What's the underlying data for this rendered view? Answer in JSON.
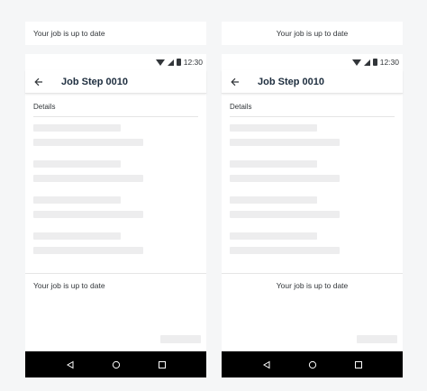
{
  "phones": [
    {
      "toast": "Your job is up to date",
      "status": {
        "time": "12:30",
        "icons": [
          "wifi-icon",
          "signal-icon",
          "battery-icon"
        ]
      },
      "appbar": {
        "title": "Job Step 0010",
        "back_icon": "arrow-left-icon"
      },
      "section_label": "Details",
      "footer_message": "Your job is up to date",
      "nav_icons": [
        "back-triangle-icon",
        "home-circle-icon",
        "recents-square-icon"
      ]
    },
    {
      "toast": "Your job is up to date",
      "status": {
        "time": "12:30",
        "icons": [
          "wifi-icon",
          "signal-icon",
          "battery-icon"
        ]
      },
      "appbar": {
        "title": "Job Step 0010",
        "back_icon": "arrow-left-icon"
      },
      "section_label": "Details",
      "footer_message": "Your job is up to date",
      "nav_icons": [
        "back-triangle-icon",
        "home-circle-icon",
        "recents-square-icon"
      ]
    }
  ],
  "colors": {
    "background": "#f5f6f7",
    "surface": "#ffffff",
    "skeleton": "#ededee",
    "text": "#32363a",
    "title": "#1d2d3e",
    "navbar": "#000000"
  }
}
